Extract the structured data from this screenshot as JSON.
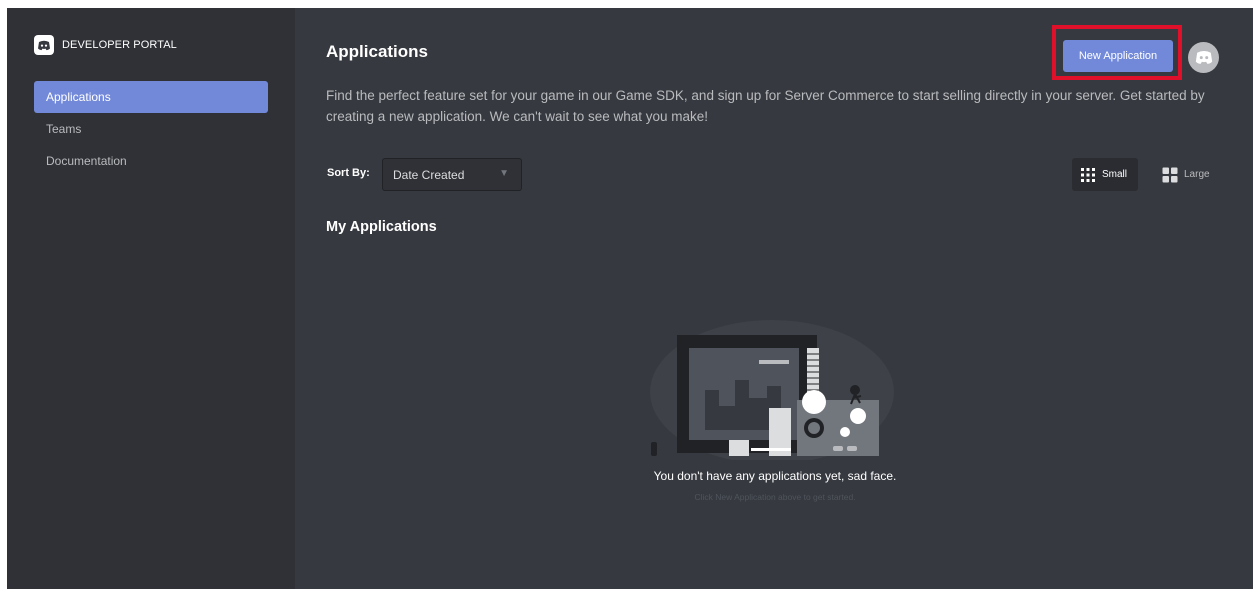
{
  "brand": {
    "name": "DEVELOPER PORTAL"
  },
  "sidebar": {
    "items": [
      {
        "label": "Applications",
        "active": true
      },
      {
        "label": "Teams",
        "active": false
      },
      {
        "label": "Documentation",
        "active": false
      }
    ]
  },
  "header": {
    "title": "Applications",
    "description": "Find the perfect feature set for your game in our Game SDK, and sign up for Server Commerce to start selling directly in your server. Get started by creating a new application. We can't wait to see what you make!",
    "new_app_label": "New Application",
    "avatar_icon": "discord-icon"
  },
  "toolbar": {
    "sort_label": "Sort By:",
    "sort_value": "Date Created",
    "size_small_label": "Small",
    "size_large_label": "Large",
    "selected_size": "Small"
  },
  "section": {
    "title": "My Applications"
  },
  "empty_state": {
    "title": "You don't have any applications yet, sad face.",
    "subtitle": "Click New Application above to get started."
  },
  "colors": {
    "background": "#36393f",
    "sidebar": "#2f3136",
    "accent": "#7289da",
    "highlight_box": "#e0102a"
  }
}
